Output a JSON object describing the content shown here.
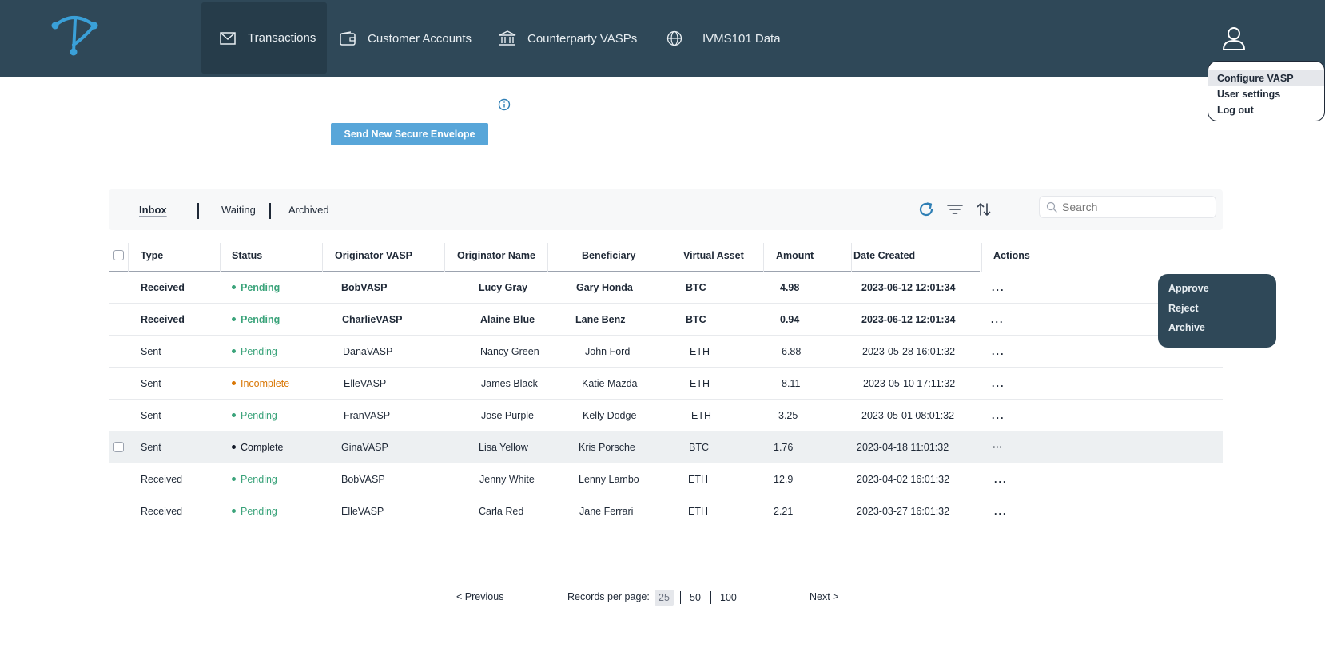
{
  "nav": {
    "items": [
      {
        "label": "Transactions",
        "icon": "envelope-icon"
      },
      {
        "label": "Customer Accounts",
        "icon": "wallet-icon"
      },
      {
        "label": "Counterparty VASPs",
        "icon": "bank-icon"
      },
      {
        "label": "IVMS101 Data",
        "icon": "globe-icon"
      }
    ]
  },
  "user_menu": {
    "items": [
      "Configure VASP",
      "User settings",
      "Log out"
    ]
  },
  "send_button": "Send New Secure Envelope",
  "tabs": [
    "Inbox",
    "Waiting",
    "Archived"
  ],
  "search": {
    "placeholder": "Search"
  },
  "columns": [
    "Type",
    "Status",
    "Originator VASP",
    "Originator Name",
    "Beneficiary",
    "Virtual Asset",
    "Amount",
    "Date Created",
    "Actions"
  ],
  "rows": [
    {
      "type": "Received",
      "status": "Pending",
      "vasp": "BobVASP",
      "orig": "Lucy Gray",
      "benef": "Gary Honda",
      "asset": "BTC",
      "amount": "4.98",
      "date": "2023-06-12 12:01:34",
      "actions": "..."
    },
    {
      "type": "Received",
      "status": "Pending",
      "vasp": "CharlieVASP",
      "orig": "Alaine Blue",
      "benef": "Lane Benz",
      "asset": "BTC",
      "amount": "0.94",
      "date": "2023-06-12 12:01:34",
      "actions": "..."
    },
    {
      "type": "Sent",
      "status": "Pending",
      "vasp": "DanaVASP",
      "orig": "Nancy Green",
      "benef": "John Ford",
      "asset": "ETH",
      "amount": "6.88",
      "date": "2023-05-28 16:01:32",
      "actions": "..."
    },
    {
      "type": "Sent",
      "status": "Incomplete",
      "vasp": "ElleVASP",
      "orig": "James Black",
      "benef": "Katie Mazda",
      "asset": "ETH",
      "amount": "8.11",
      "date": "2023-05-10 17:11:32",
      "actions": "..."
    },
    {
      "type": "Sent",
      "status": "Pending",
      "vasp": "FranVASP",
      "orig": "Jose Purple",
      "benef": "Kelly Dodge",
      "asset": "ETH",
      "amount": "3.25",
      "date": "2023-05-01 08:01:32",
      "actions": "..."
    },
    {
      "type": "Sent",
      "status": "Complete",
      "vasp": "GinaVASP",
      "orig": "Lisa Yellow",
      "benef": "Kris Porsche",
      "asset": "BTC",
      "amount": "1.76",
      "date": "2023-04-18 11:01:32",
      "actions": "···"
    },
    {
      "type": "Received",
      "status": "Pending",
      "vasp": "BobVASP",
      "orig": "Jenny White",
      "benef": "Lenny Lambo",
      "asset": "ETH",
      "amount": "12.9",
      "date": "2023-04-02 16:01:32",
      "actions": "..."
    },
    {
      "type": "Received",
      "status": "Pending",
      "vasp": "ElleVASP",
      "orig": "Carla Red",
      "benef": "Jane Ferrari",
      "asset": "ETH",
      "amount": "2.21",
      "date": "2023-03-27 16:01:32",
      "actions": "..."
    }
  ],
  "action_menu": {
    "items": [
      "Approve",
      "Reject",
      "Archive"
    ]
  },
  "pagination": {
    "previous": "<  Previous",
    "records_label": "Records per page:",
    "options": [
      "25",
      "50",
      "100"
    ],
    "selected": "25",
    "next": "Next  >"
  },
  "colors": {
    "nav_bg": "#2f4858",
    "accent": "#58a6d9",
    "pending": "#3aa37a",
    "incomplete": "#d97706",
    "complete": "#111827"
  }
}
